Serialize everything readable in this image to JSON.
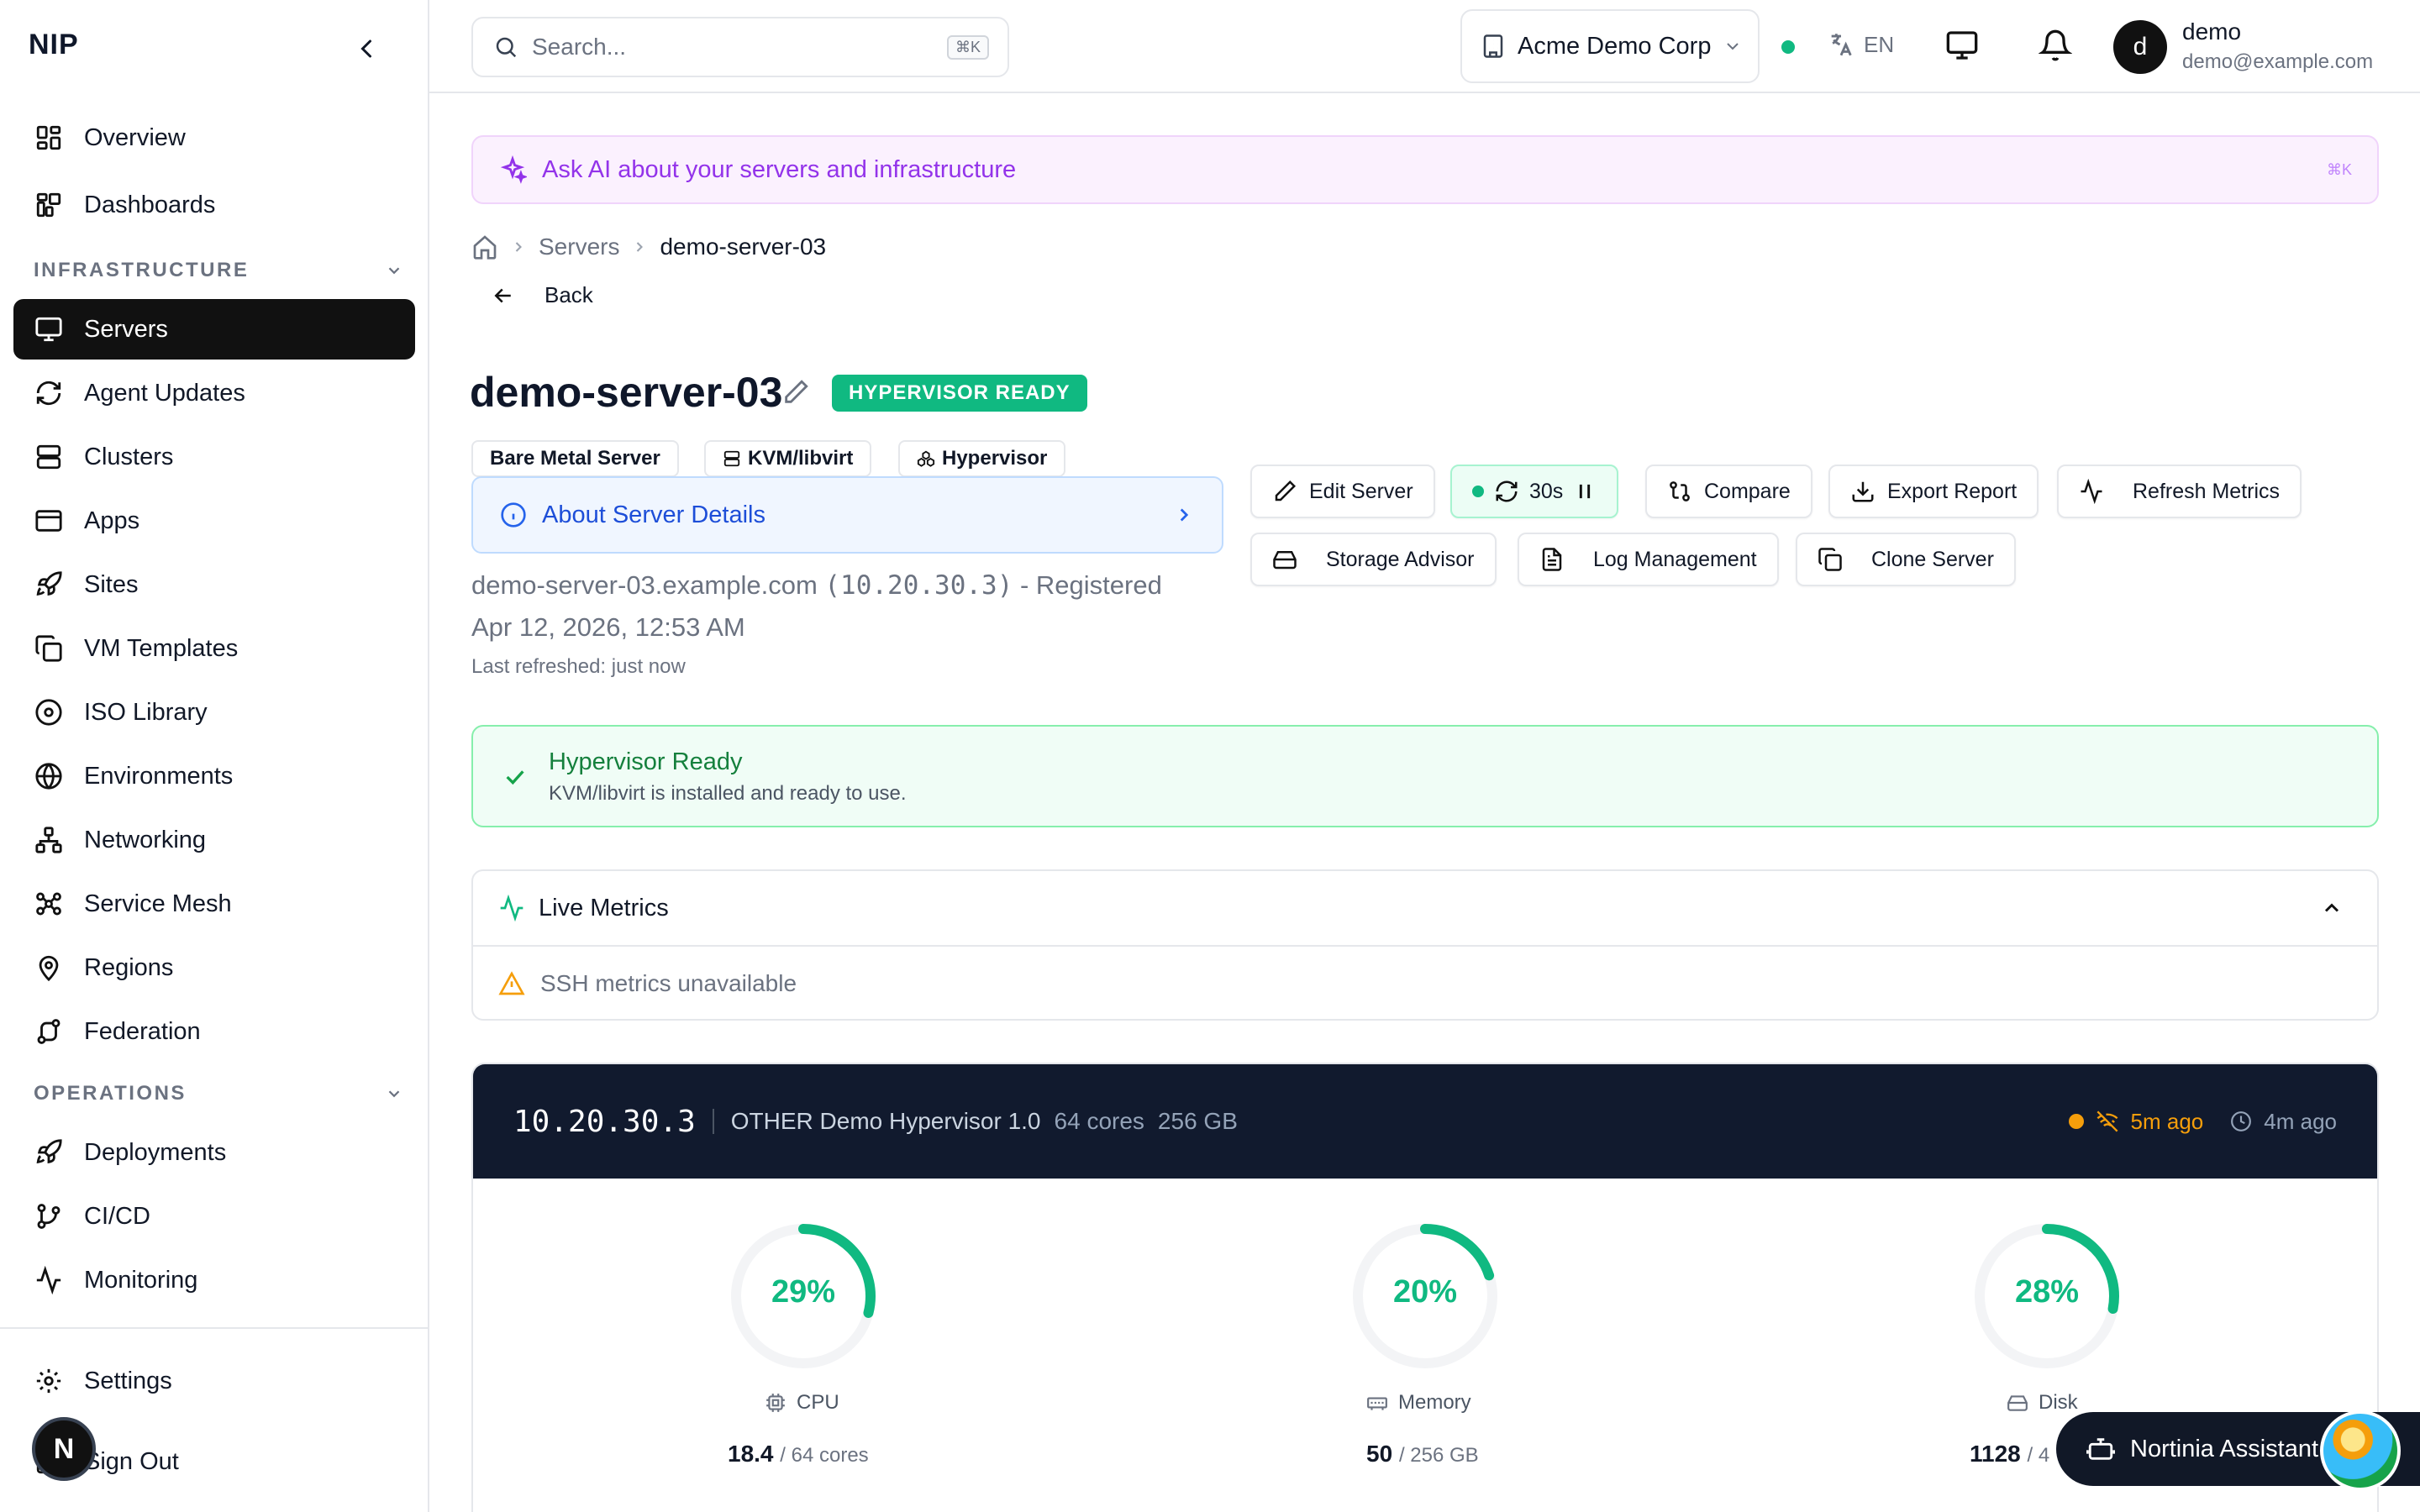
{
  "app": {
    "brand": "NIP"
  },
  "sidebar": {
    "items_top": [
      {
        "label": "Overview",
        "icon": "grid-icon"
      },
      {
        "label": "Dashboards",
        "icon": "dashboard-icon"
      }
    ],
    "section_infra": "INFRASTRUCTURE",
    "items_infra": [
      {
        "label": "Servers",
        "icon": "monitor-icon",
        "active": true
      },
      {
        "label": "Agent Updates",
        "icon": "refresh-icon"
      },
      {
        "label": "Clusters",
        "icon": "server-stack-icon"
      },
      {
        "label": "Apps",
        "icon": "window-icon"
      },
      {
        "label": "Sites",
        "icon": "rocket-icon"
      },
      {
        "label": "VM Templates",
        "icon": "copy-icon"
      },
      {
        "label": "ISO Library",
        "icon": "disc-icon"
      },
      {
        "label": "Environments",
        "icon": "globe-icon"
      },
      {
        "label": "Networking",
        "icon": "network-icon"
      },
      {
        "label": "Service Mesh",
        "icon": "mesh-icon"
      },
      {
        "label": "Regions",
        "icon": "map-pin-icon"
      },
      {
        "label": "Federation",
        "icon": "route-icon"
      }
    ],
    "section_ops": "OPERATIONS",
    "items_ops": [
      {
        "label": "Deployments",
        "icon": "rocket-icon"
      },
      {
        "label": "CI/CD",
        "icon": "git-branch-icon"
      },
      {
        "label": "Monitoring",
        "icon": "activity-icon"
      }
    ],
    "settings": "Settings",
    "sign_out": "Sign Out",
    "avatar_letter": "N"
  },
  "topbar": {
    "search_placeholder": "Search...",
    "search_kbd": "⌘K",
    "org": "Acme Demo Corp",
    "lang": "EN",
    "user_initial": "d",
    "user_name": "demo",
    "user_email": "demo@example.com"
  },
  "ai_bar": {
    "label": "Ask AI about your servers and infrastructure",
    "kbd": "⌘K"
  },
  "breadcrumb": {
    "parent": "Servers",
    "current": "demo-server-03"
  },
  "back_label": "Back",
  "server": {
    "name": "demo-server-03",
    "badge": "HYPERVISOR READY",
    "tags": [
      "Bare Metal Server",
      "KVM/libvirt",
      "Hypervisor"
    ],
    "about": "About Server Details",
    "hostname": "demo-server-03.example.com",
    "ip_paren": "(10.20.30.3)",
    "registered": "- Registered",
    "registered_date": "Apr 12, 2026, 12:53 AM",
    "last_refreshed": "Last refreshed: just now"
  },
  "actions": {
    "edit": "Edit Server",
    "interval": "30s",
    "compare": "Compare",
    "export": "Export Report",
    "refresh": "Refresh Metrics",
    "storage": "Storage Advisor",
    "logs": "Log Management",
    "clone": "Clone Server"
  },
  "ready_box": {
    "title": "Hypervisor Ready",
    "subtitle": "KVM/libvirt is installed and ready to use."
  },
  "live_metrics": {
    "title": "Live Metrics",
    "warning": "SSH metrics unavailable"
  },
  "card": {
    "ip": "10.20.30.3",
    "os": "OTHER Demo Hypervisor 1.0",
    "cores": "64 cores",
    "mem": "256 GB",
    "stale": "5m ago",
    "updated": "4m ago"
  },
  "gauges": [
    {
      "label": "CPU",
      "value": 29,
      "value_text": "29%",
      "used": "18.4",
      "total": "/ 64 cores",
      "icon": "cpu-icon"
    },
    {
      "label": "Memory",
      "value": 20,
      "value_text": "20%",
      "used": "50",
      "total": "/ 256 GB",
      "icon": "memory-icon"
    },
    {
      "label": "Disk",
      "value": 28,
      "value_text": "28%",
      "used": "1128",
      "total": "/ 4",
      "icon": "hard-drive-icon"
    }
  ],
  "assistant": {
    "label": "Nortinia Assistant"
  },
  "colors": {
    "accent": "#10b981",
    "ai": "#9333ea",
    "info": "#1d4ed8",
    "warn": "#f59e0b",
    "dark": "#111a2e"
  }
}
